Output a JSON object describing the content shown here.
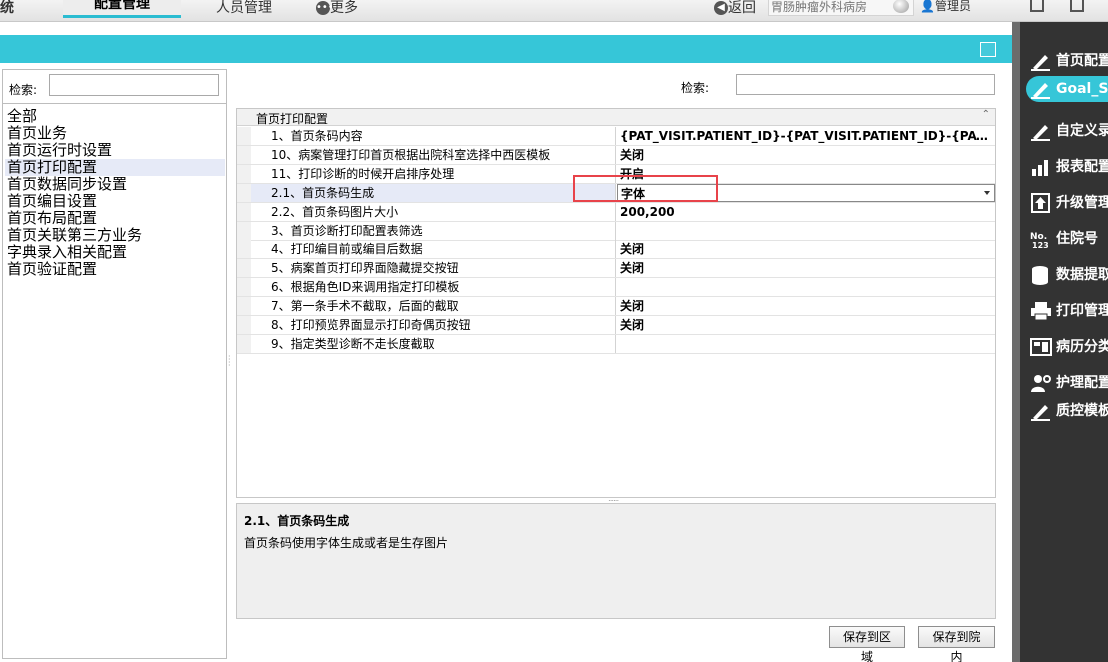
{
  "topbar": {
    "title_partial": "统",
    "tab_config": "配置管理",
    "tab_staff": "人员管理",
    "more": "更多",
    "more_icon": "ellipsis-circle-icon",
    "back": "返回",
    "back_icon": "back-arrow-icon",
    "dept": "胃肠肿瘤外科病房",
    "user": "管理员"
  },
  "left_panel": {
    "search_label": "检索:",
    "search_value": "",
    "tree": [
      "全部",
      "首页业务",
      "首页运行时设置",
      "首页打印配置",
      "首页数据同步设置",
      "首页编目设置",
      "首页布局配置",
      "首页关联第三方业务",
      "字典录入相关配置",
      "首页验证配置"
    ],
    "selected_index": 3
  },
  "main": {
    "search_label": "检索:",
    "search_value": "",
    "grid": {
      "category": "首页打印配置",
      "rows": [
        {
          "label": "1、首页条码内容",
          "value": "{PAT_VISIT.PATIENT_ID}-{PAT_VISIT.PATIENT_ID}-{PAT_..."
        },
        {
          "label": "10、病案管理打印首页根据出院科室选择中西医模板",
          "value": "关闭"
        },
        {
          "label": "11、打印诊断的时候开启排序处理",
          "value": "开启"
        },
        {
          "label": "2.1、首页条码生成",
          "value": "字体"
        },
        {
          "label": "2.2、首页条码图片大小",
          "value": "200,200"
        },
        {
          "label": "3、首页诊断打印配置表筛选",
          "value": ""
        },
        {
          "label": "4、打印编目前或编目后数据",
          "value": "关闭"
        },
        {
          "label": "5、病案首页打印界面隐藏提交按钮",
          "value": "关闭"
        },
        {
          "label": "6、根据角色ID来调用指定打印模板",
          "value": ""
        },
        {
          "label": "7、第一条手术不截取，后面的截取",
          "value": "关闭"
        },
        {
          "label": "8、打印预览界面显示打印奇偶页按钮",
          "value": "关闭"
        },
        {
          "label": "9、指定类型诊断不走长度截取",
          "value": ""
        }
      ],
      "selected_index": 3
    },
    "description": {
      "title": "2.1、首页条码生成",
      "text": "首页条码使用字体生成或者是生存图片"
    },
    "buttons": {
      "save_region": "保存到区域",
      "save_hospital": "保存到院内"
    }
  },
  "right_sidebar": {
    "items": [
      {
        "label": "首页配置",
        "icon": "edit-pen-icon"
      },
      {
        "label": "Goal_S",
        "icon": "edit-pen-icon"
      },
      {
        "label": "自定义录",
        "icon": "edit-pen-icon"
      },
      {
        "label": "报表配置",
        "icon": "bar-chart-icon"
      },
      {
        "label": "升级管理",
        "icon": "upload-arrow-icon"
      },
      {
        "label": "住院号",
        "icon": "number-icon"
      },
      {
        "label": "数据提取",
        "icon": "database-icon"
      },
      {
        "label": "打印管理",
        "icon": "printer-icon"
      },
      {
        "label": "病历分类",
        "icon": "record-icon"
      },
      {
        "label": "护理配置",
        "icon": "nurse-gear-icon"
      },
      {
        "label": "质控模板",
        "icon": "edit-pen-icon"
      }
    ],
    "active_index": 1
  },
  "colors": {
    "accent": "#36c6d8",
    "selection": "#e6eaf7",
    "highlight_box": "#e8434a",
    "sidebar_bg": "#333333"
  }
}
